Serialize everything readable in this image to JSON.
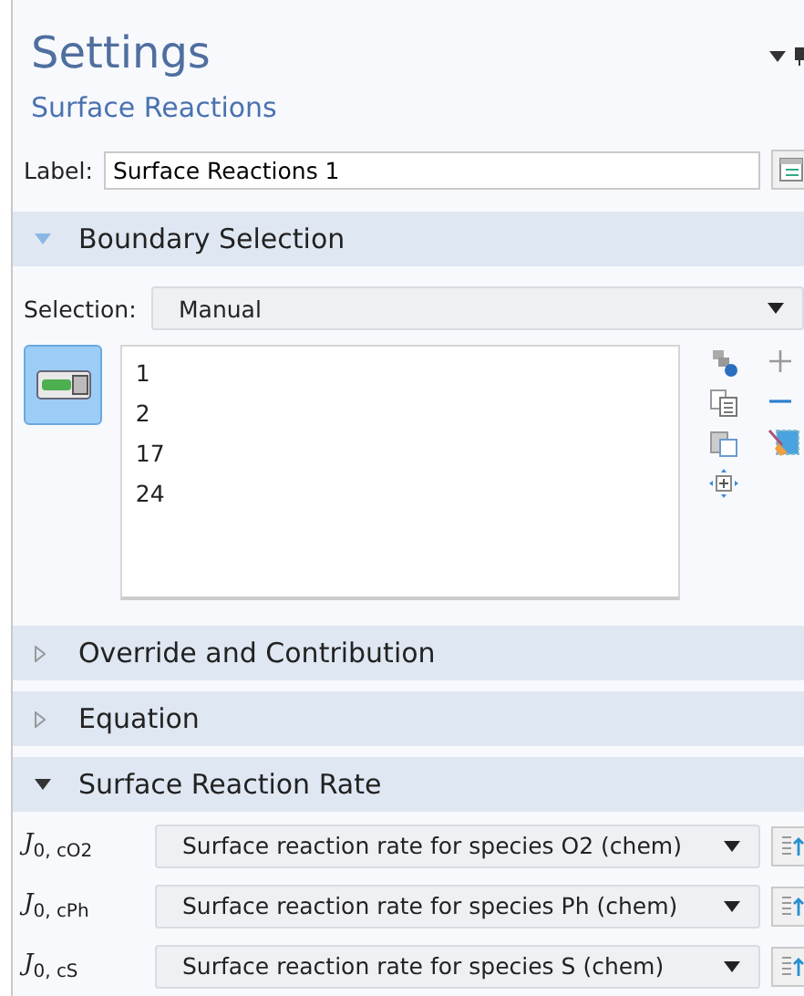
{
  "panel": {
    "title": "Settings",
    "subtitle": "Surface Reactions"
  },
  "label_field": {
    "label": "Label:",
    "value": "Surface Reactions 1"
  },
  "sections": [
    {
      "title": "Boundary Selection",
      "expanded": true,
      "kind": "selection"
    },
    {
      "title": "Override and Contribution",
      "expanded": false
    },
    {
      "title": "Equation",
      "expanded": false
    },
    {
      "title": "Surface Reaction Rate",
      "expanded": true,
      "kind": "rates"
    }
  ],
  "boundary_selection": {
    "label": "Selection:",
    "value": "Manual",
    "active_toggle": true,
    "items": [
      "1",
      "2",
      "17",
      "24"
    ]
  },
  "rates": [
    {
      "symbol": "*J*$_{0, cO2}$",
      "value": "Surface reaction rate for species O2 (chem)"
    },
    {
      "symbol": "*J*$_{0, cPh}$",
      "value": "Surface reaction rate for species Ph (chem)"
    },
    {
      "symbol": "*J*$_{0, cS}$",
      "value": "Surface reaction rate for species S (chem)"
    }
  ]
}
